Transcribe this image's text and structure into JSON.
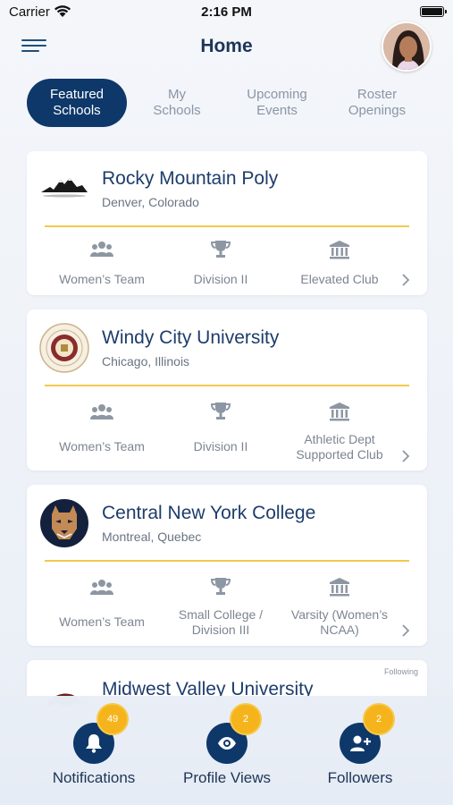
{
  "status_bar": {
    "carrier": "Carrier",
    "time": "2:16 PM"
  },
  "header": {
    "title": "Home"
  },
  "tabs": [
    {
      "label": "Featured\nSchools",
      "active": true
    },
    {
      "label": "My\nSchools",
      "active": false
    },
    {
      "label": "Upcoming\nEvents",
      "active": false
    },
    {
      "label": "Roster\nOpenings",
      "active": false
    }
  ],
  "schools": [
    {
      "name": "Rocky Mountain Poly",
      "location": "Denver, Colorado",
      "team": "Women’s Team",
      "division": "Division II",
      "club": "Elevated Club"
    },
    {
      "name": "Windy City University",
      "location": "Chicago, Illinois",
      "team": "Women’s Team",
      "division": "Division II",
      "club": "Athletic Dept\nSupported Club"
    },
    {
      "name": "Central New York College",
      "location": "Montreal, Quebec",
      "team": "Women’s Team",
      "division": "Small College /\nDivision III",
      "club": "Varsity (Women’s\nNCAA)"
    },
    {
      "name": "Midwest Valley University",
      "following": "Following"
    }
  ],
  "bottom_nav": [
    {
      "label": "Notifications",
      "badge": "49",
      "icon": "bell-icon"
    },
    {
      "label": "Profile Views",
      "badge": "2",
      "icon": "eye-icon"
    },
    {
      "label": "Followers",
      "badge": "2",
      "icon": "add-user-icon"
    }
  ],
  "colors": {
    "primary": "#0e3869",
    "accent": "#f5b41c",
    "divider": "#f2c94c"
  }
}
